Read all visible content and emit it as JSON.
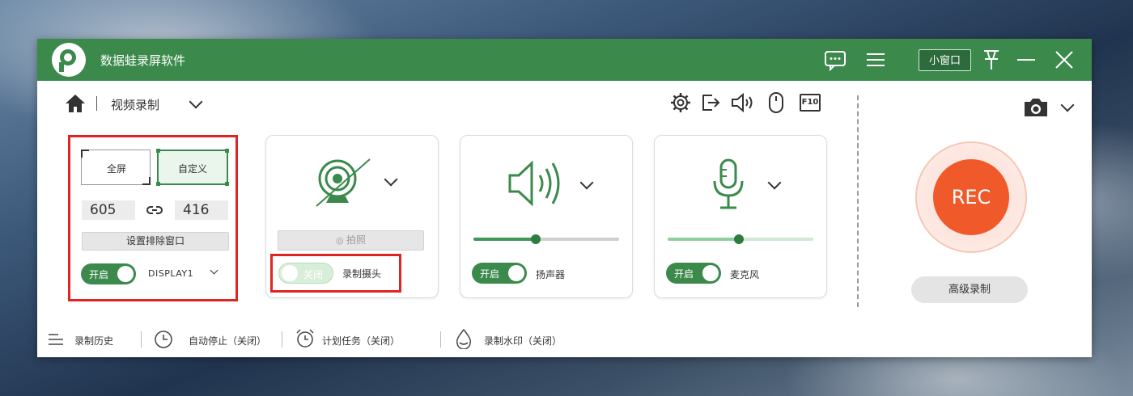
{
  "titlebar": {
    "app_title": "数据蛙录屏软件",
    "mini_window_label": "小窗口",
    "icons": [
      "chat-icon",
      "menu-icon",
      "pin-icon",
      "minimize-icon",
      "close-icon"
    ]
  },
  "toolbar": {
    "mode_label": "视频录制",
    "icons": [
      "home-icon",
      "gear-icon",
      "export-icon",
      "speaker-icon",
      "mouse-icon",
      "f10-hotkey-icon",
      "camera-icon"
    ],
    "f10_label": "F10"
  },
  "area_card": {
    "fullscreen_label": "全屏",
    "custom_label": "自定义",
    "width_value": "605",
    "height_value": "416",
    "exclude_window_label": "设置排除窗口",
    "toggle_label": "开启",
    "display_value": "DISPLAY1"
  },
  "webcam_card": {
    "snapshot_label": "拍照",
    "toggle_label": "关闭",
    "caption": "录制摄头"
  },
  "speaker_card": {
    "toggle_label": "开启",
    "caption": "扬声器",
    "volume_fraction": 0.43
  },
  "mic_card": {
    "toggle_label": "开启",
    "caption": "麦克风",
    "volume_fraction": 0.49
  },
  "rec": {
    "label": "REC",
    "advanced_label": "高级录制",
    "accent": "#f05a2a"
  },
  "footer": {
    "history_label": "录制历史",
    "auto_stop_label": "自动停止（关闭）",
    "schedule_label": "计划任务（关闭）",
    "watermark_label": "录制水印（关闭）"
  },
  "colors": {
    "brand_green": "#3b8a4c",
    "highlight_red": "#e02323"
  }
}
